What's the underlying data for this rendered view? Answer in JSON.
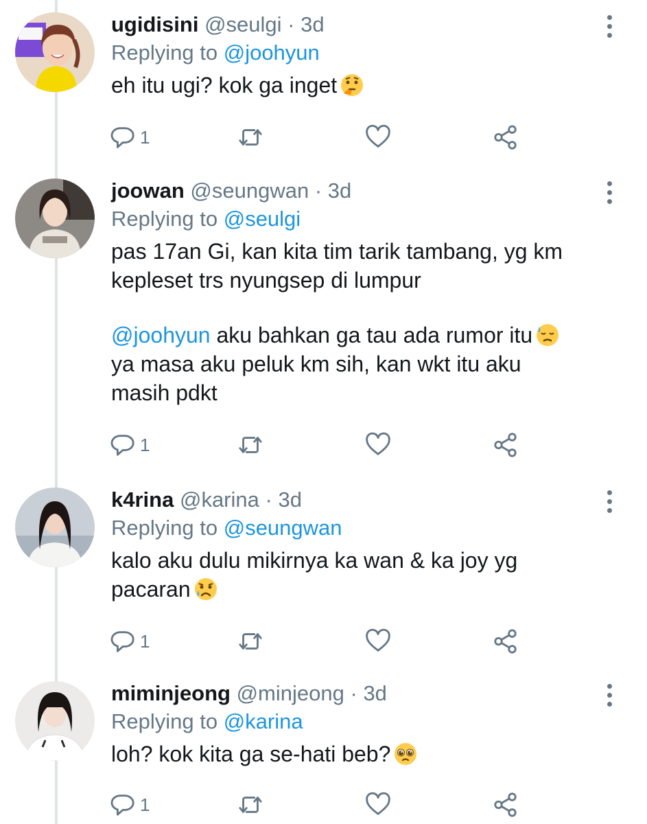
{
  "tweets": [
    {
      "name": "ugidisini",
      "handle": "@seulgi",
      "sep": "·",
      "time": "3d",
      "replying_prefix": "Replying to",
      "replying_to": "@joohyun",
      "lines": [
        "eh itu ugi? kok ga inget"
      ],
      "emoji": "thinking-face",
      "reply_count": "1"
    },
    {
      "name": "joowan",
      "handle": "@seungwan",
      "sep": "·",
      "time": "3d",
      "replying_prefix": "Replying to",
      "replying_to": "@seulgi",
      "lines": [
        "pas 17an Gi, kan kita tim tarik tambang, yg km",
        "kepleset trs nyungsep di lumpur"
      ],
      "second_mention": "@joohyun",
      "second_text": " aku bahkan ga tau ada rumor itu",
      "second_lines": [
        "ya masa aku peluk km sih, kan wkt itu aku",
        "masih pdkt"
      ],
      "emoji": "downcast-sweat-face",
      "reply_count": "1"
    },
    {
      "name": "k4rina",
      "handle": "@karina",
      "sep": "·",
      "time": "3d",
      "replying_prefix": "Replying to",
      "replying_to": "@seungwan",
      "lines": [
        "kalo aku dulu mikirnya ka wan & ka joy yg",
        "pacaran"
      ],
      "emoji": "sad-relieved-face",
      "reply_count": "1"
    },
    {
      "name": "miminjeong",
      "handle": "@minjeong",
      "sep": "·",
      "time": "3d",
      "replying_prefix": "Replying to",
      "replying_to": "@karina",
      "lines": [
        "loh? kok kita ga se-hati beb?"
      ],
      "emoji": "pleading-face",
      "reply_count": "1"
    }
  ],
  "icons": [
    "reply-icon",
    "retweet-icon",
    "like-icon",
    "share-icon",
    "more-options-icon"
  ],
  "colors": {
    "mention": "#1b95e0",
    "muted": "#657786",
    "text": "#14171a",
    "thread_line": "#dfe3e6"
  }
}
